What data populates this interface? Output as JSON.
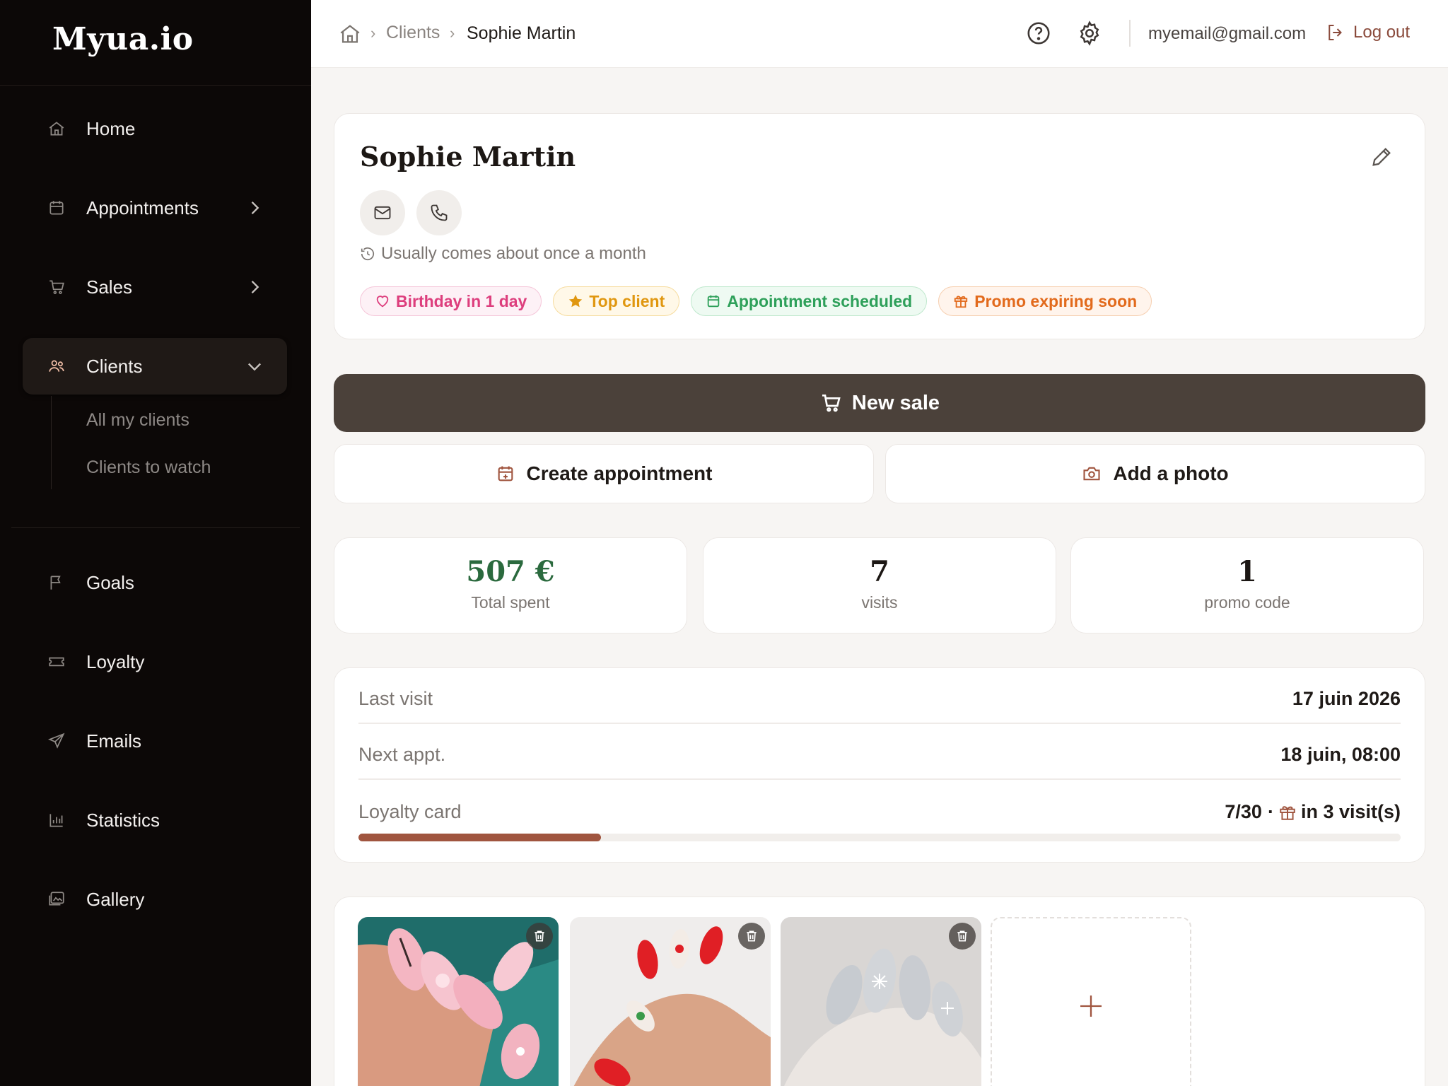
{
  "app": {
    "logo": "Myua.io"
  },
  "sidebar": {
    "items": [
      {
        "label": "Home",
        "icon": "home-icon"
      },
      {
        "label": "Appointments",
        "icon": "calendar-icon"
      },
      {
        "label": "Sales",
        "icon": "cart-icon"
      },
      {
        "label": "Clients",
        "icon": "users-icon"
      },
      {
        "label": "Goals",
        "icon": "flag-icon"
      },
      {
        "label": "Loyalty",
        "icon": "ticket-icon"
      },
      {
        "label": "Emails",
        "icon": "send-icon"
      },
      {
        "label": "Statistics",
        "icon": "bar-chart-icon"
      },
      {
        "label": "Gallery",
        "icon": "image-icon"
      }
    ],
    "clients_sub": [
      "All my clients",
      "Clients to watch"
    ]
  },
  "topbar": {
    "breadcrumb": {
      "sep": "›",
      "clients": "Clients",
      "current": "Sophie Martin"
    },
    "email": "myemail@gmail.com",
    "logout": "Log out"
  },
  "client": {
    "name": "Sophie Martin",
    "frequency": "Usually comes about once a month",
    "tags": {
      "birthday": "Birthday in 1 day",
      "top": "Top client",
      "appointment": "Appointment scheduled",
      "promo": "Promo expiring soon"
    }
  },
  "actions": {
    "new_sale": "New sale",
    "create_appointment": "Create appointment",
    "add_photo": "Add a photo"
  },
  "stats": {
    "total_spent": {
      "value": "507 €",
      "label": "Total spent"
    },
    "visits": {
      "value": "7",
      "label": "visits"
    },
    "promo": {
      "value": "1",
      "label": "promo code"
    }
  },
  "info": {
    "last_visit": {
      "label": "Last visit",
      "value": "17 juin 2026"
    },
    "next_appt": {
      "label": "Next appt.",
      "value": "18 juin, 08:00"
    },
    "loyalty": {
      "label": "Loyalty card",
      "progress": "7/30",
      "dot": "·",
      "reward": "in 3 visit(s)",
      "fraction": 0.233
    }
  },
  "colors": {
    "accent": "#a0553f",
    "primary_button": "#4b413a",
    "sidebar_bg": "#0c0807"
  }
}
